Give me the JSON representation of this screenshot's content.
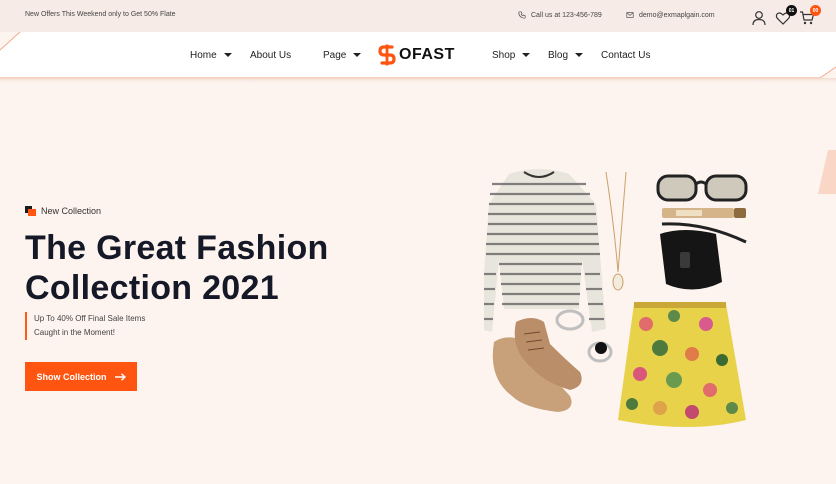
{
  "topbar": {
    "offer": "New Offers This Weekend only to Get 50% Flate",
    "phone": "Call us at 123-456-789",
    "email": "demo@exmaplgain.com",
    "wishlist_count": "01",
    "cart_count": "00"
  },
  "nav": {
    "home": "Home",
    "about": "About Us",
    "page": "Page",
    "shop": "Shop",
    "blog": "Blog",
    "contact": "Contact Us"
  },
  "logo": {
    "text": "OFAST"
  },
  "hero": {
    "tag": "New Collection",
    "title_line1": "The Great Fashion",
    "title_line2": "Collection 2021",
    "sub_line1": "Up To 40% Off Final Sale Items",
    "sub_line2": "Caught in the Moment!",
    "button": "Show Collection"
  },
  "colors": {
    "accent": "#ff5511",
    "background": "#fdf3ef",
    "topbar": "#f6ebe6"
  },
  "icons": [
    "phone-icon",
    "mail-icon",
    "user-icon",
    "heart-icon",
    "cart-icon",
    "arrow-right-icon"
  ]
}
